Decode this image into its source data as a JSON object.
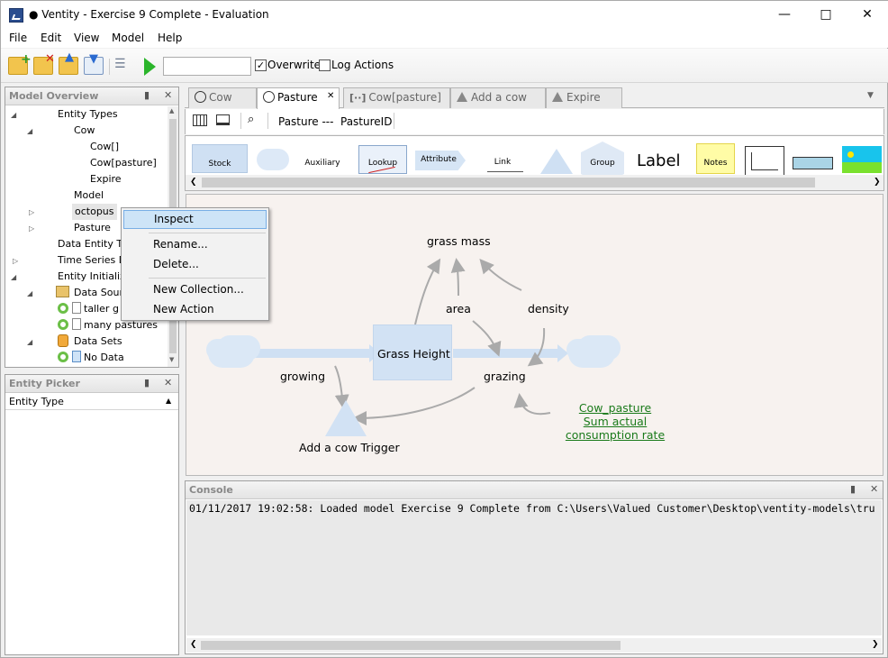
{
  "window": {
    "title": "● Ventity - Exercise 9 Complete - Evaluation"
  },
  "menu": [
    "File",
    "Edit",
    "View",
    "Model",
    "Help"
  ],
  "toolbar": {
    "overwrite_label": "Overwrite",
    "log_actions_label": "Log Actions",
    "run_value": ""
  },
  "model_overview": {
    "title": "Model Overview",
    "items": [
      {
        "label": "Entity Types"
      },
      {
        "label": "Cow"
      },
      {
        "label": "Cow[]"
      },
      {
        "label": "Cow[pasture]"
      },
      {
        "label": "Expire"
      },
      {
        "label": "Model"
      },
      {
        "label": "octopus"
      },
      {
        "label": "Pasture"
      },
      {
        "label": "Data Entity Ty"
      },
      {
        "label": "Time Series Da"
      },
      {
        "label": "Entity Initializ"
      },
      {
        "label": "Data Sourc"
      },
      {
        "label": "taller g"
      },
      {
        "label": "many pastures"
      },
      {
        "label": "Data Sets"
      },
      {
        "label": "No Data"
      }
    ]
  },
  "entity_picker": {
    "title": "Entity Picker",
    "column": "Entity Type"
  },
  "tabs": [
    "Cow",
    "Pasture",
    "Cow[pasture]",
    "Add a cow",
    "Expire"
  ],
  "subtoolbar": {
    "entity_text": "Pasture ---",
    "id_text": "PastureID"
  },
  "palette": [
    "Stock",
    "Auxiliary",
    "Lookup",
    "Attribute",
    "Link",
    "Group",
    "Label",
    "Notes"
  ],
  "diagram": {
    "grass_mass": "grass mass",
    "area": "area",
    "density": "density",
    "grass_height": "Grass Height",
    "growing": "growing",
    "grazing": "grazing",
    "trigger": "Add a cow Trigger",
    "link_lines": [
      "Cow_pasture",
      "Sum actual",
      "consumption rate"
    ]
  },
  "context_menu": [
    "Inspect",
    "Rename...",
    "Delete...",
    "New Collection...",
    "New Action"
  ],
  "console": {
    "title": "Console",
    "line": "01/11/2017 19:02:58: Loaded model Exercise 9 Complete from C:\\Users\\Valued Customer\\Desktop\\ventity-models\\tru"
  },
  "colors": {
    "accent": "#3c7fd0",
    "link_green": "#1a7a1a",
    "run_green": "#2bb52b",
    "highlight": "#cde4f7"
  }
}
